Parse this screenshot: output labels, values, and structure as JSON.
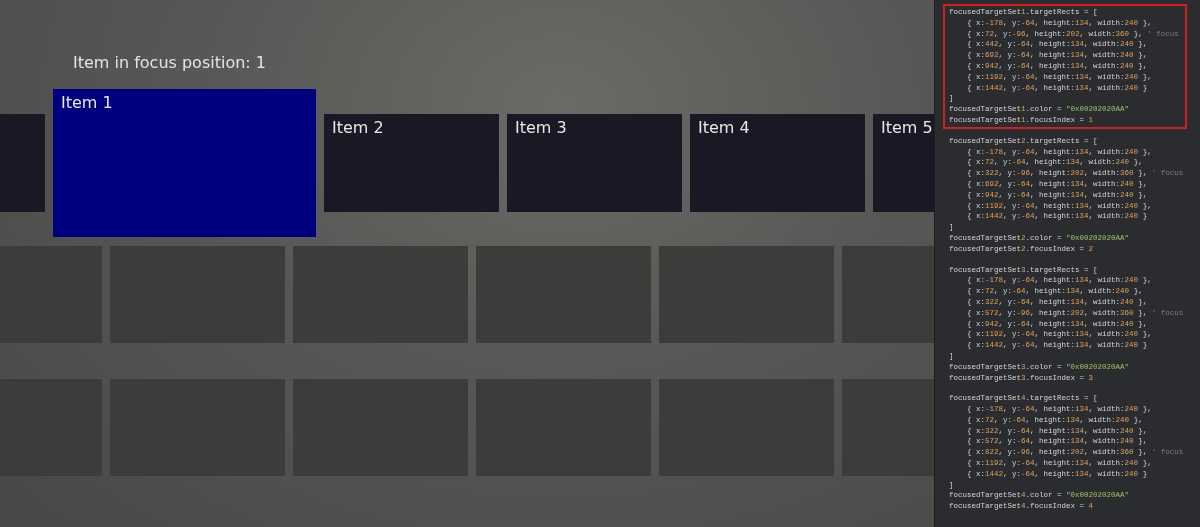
{
  "heading": "Item in focus position: 1",
  "items": [
    {
      "selected": false
    },
    {
      "label": "Item 1",
      "selected": true
    },
    {
      "label": "Item 2",
      "selected": false
    },
    {
      "label": "Item 3",
      "selected": false
    },
    {
      "label": "Item 4",
      "selected": false
    },
    {
      "label": "Item 5",
      "selected": false
    }
  ],
  "code_blocks": [
    {
      "highlighted": true,
      "lines": [
        "focusedTargetSet1.targetRects = [",
        "    { x:-178, y:-64, height:134, width:240 },",
        "    { x:72, y:-96, height:202, width:360 }, ' focus",
        "    { x:442, y:-64, height:134, width:240 },",
        "    { x:692, y:-64, height:134, width:240 },",
        "    { x:942, y:-64, height:134, width:240 },",
        "    { x:1192, y:-64, height:134, width:240 },",
        "    { x:1442, y:-64, height:134, width:240 }",
        "]",
        "focusedTargetSet1.color = \"0x00202020AA\"",
        "focusedTargetSet1.focusIndex = 1"
      ]
    },
    {
      "highlighted": false,
      "lines": [
        "focusedTargetSet2.targetRects = [",
        "    { x:-178, y:-64, height:134, width:240 },",
        "    { x:72, y:-64, height:134, width:240 },",
        "    { x:322, y:-96, height:202, width:360 }, ' focus",
        "    { x:692, y:-64, height:134, width:240 },",
        "    { x:942, y:-64, height:134, width:240 },",
        "    { x:1192, y:-64, height:134, width:240 },",
        "    { x:1442, y:-64, height:134, width:240 }",
        "]",
        "focusedTargetSet2.color = \"0x00202020AA\"",
        "focusedTargetSet2.focusIndex = 2"
      ]
    },
    {
      "highlighted": false,
      "lines": [
        "focusedTargetSet3.targetRects = [",
        "    { x:-178, y:-64, height:134, width:240 },",
        "    { x:72, y:-64, height:134, width:240 },",
        "    { x:322, y:-64, height:134, width:240 },",
        "    { x:572, y:-96, height:202, width:360 }, ' focus",
        "    { x:942, y:-64, height:134, width:240 },",
        "    { x:1192, y:-64, height:134, width:240 },",
        "    { x:1442, y:-64, height:134, width:240 }",
        "]",
        "focusedTargetSet3.color = \"0x00202020AA\"",
        "focusedTargetSet3.focusIndex = 3"
      ]
    },
    {
      "highlighted": false,
      "lines": [
        "focusedTargetSet4.targetRects = [",
        "    { x:-178, y:-64, height:134, width:240 },",
        "    { x:72, y:-64, height:134, width:240 },",
        "    { x:322, y:-64, height:134, width:240 },",
        "    { x:572, y:-64, height:134, width:240 },",
        "    { x:822, y:-96, height:202, width:360 }, ' focus",
        "    { x:1192, y:-64, height:134, width:240 },",
        "    { x:1442, y:-64, height:134, width:240 }",
        "]",
        "focusedTargetSet4.color = \"0x00202020AA\"",
        "focusedTargetSet4.focusIndex = 4"
      ]
    }
  ]
}
